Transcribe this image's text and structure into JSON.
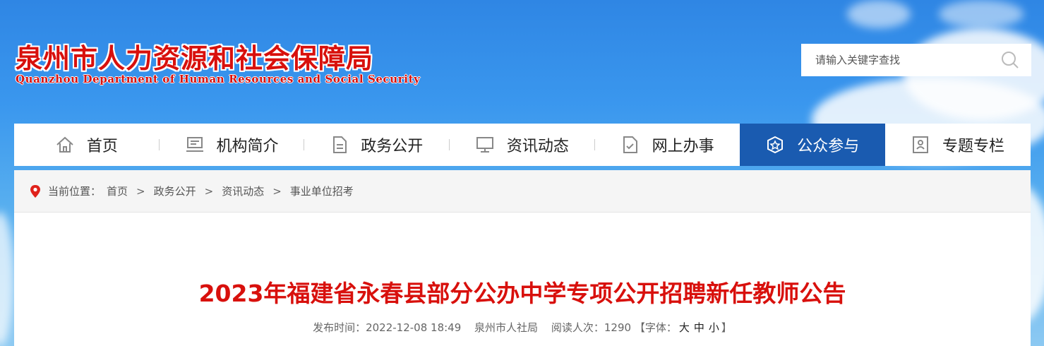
{
  "header": {
    "site_name_cn": "泉州市人力资源和社会保障局",
    "site_name_en": "Quanzhou Department of Human Resources and Social Security"
  },
  "search": {
    "placeholder": "请输入关键字查找",
    "value": "",
    "icon": "search-icon"
  },
  "nav": {
    "items": [
      {
        "label": "首页",
        "icon": "home-icon"
      },
      {
        "label": "机构简介",
        "icon": "organization-icon"
      },
      {
        "label": "政务公开",
        "icon": "document-icon"
      },
      {
        "label": "资讯动态",
        "icon": "monitor-icon"
      },
      {
        "label": "网上办事",
        "icon": "form-icon"
      },
      {
        "label": "公众参与",
        "icon": "badge-star-icon",
        "active": true
      },
      {
        "label": "专题专栏",
        "icon": "profile-icon"
      }
    ],
    "active_color": "#1a5bb0"
  },
  "breadcrumb": {
    "prefix": "当前位置：",
    "items": [
      "首页",
      "政务公开",
      "资讯动态",
      "事业单位招考"
    ],
    "separator": ">"
  },
  "article": {
    "title": "2023年福建省永春县部分公办中学专项公开招聘新任教师公告",
    "publish_label": "发布时间：",
    "publish_time": "2022-12-08 18:49",
    "source": "泉州市人社局",
    "views_label": "阅读人次：",
    "views": "1290",
    "font_label_open": "【字体：",
    "font_sizes": [
      "大",
      "中",
      "小"
    ],
    "font_label_close": "】"
  },
  "colors": {
    "brand_red": "#d8100c",
    "nav_active": "#1a5bb0"
  }
}
